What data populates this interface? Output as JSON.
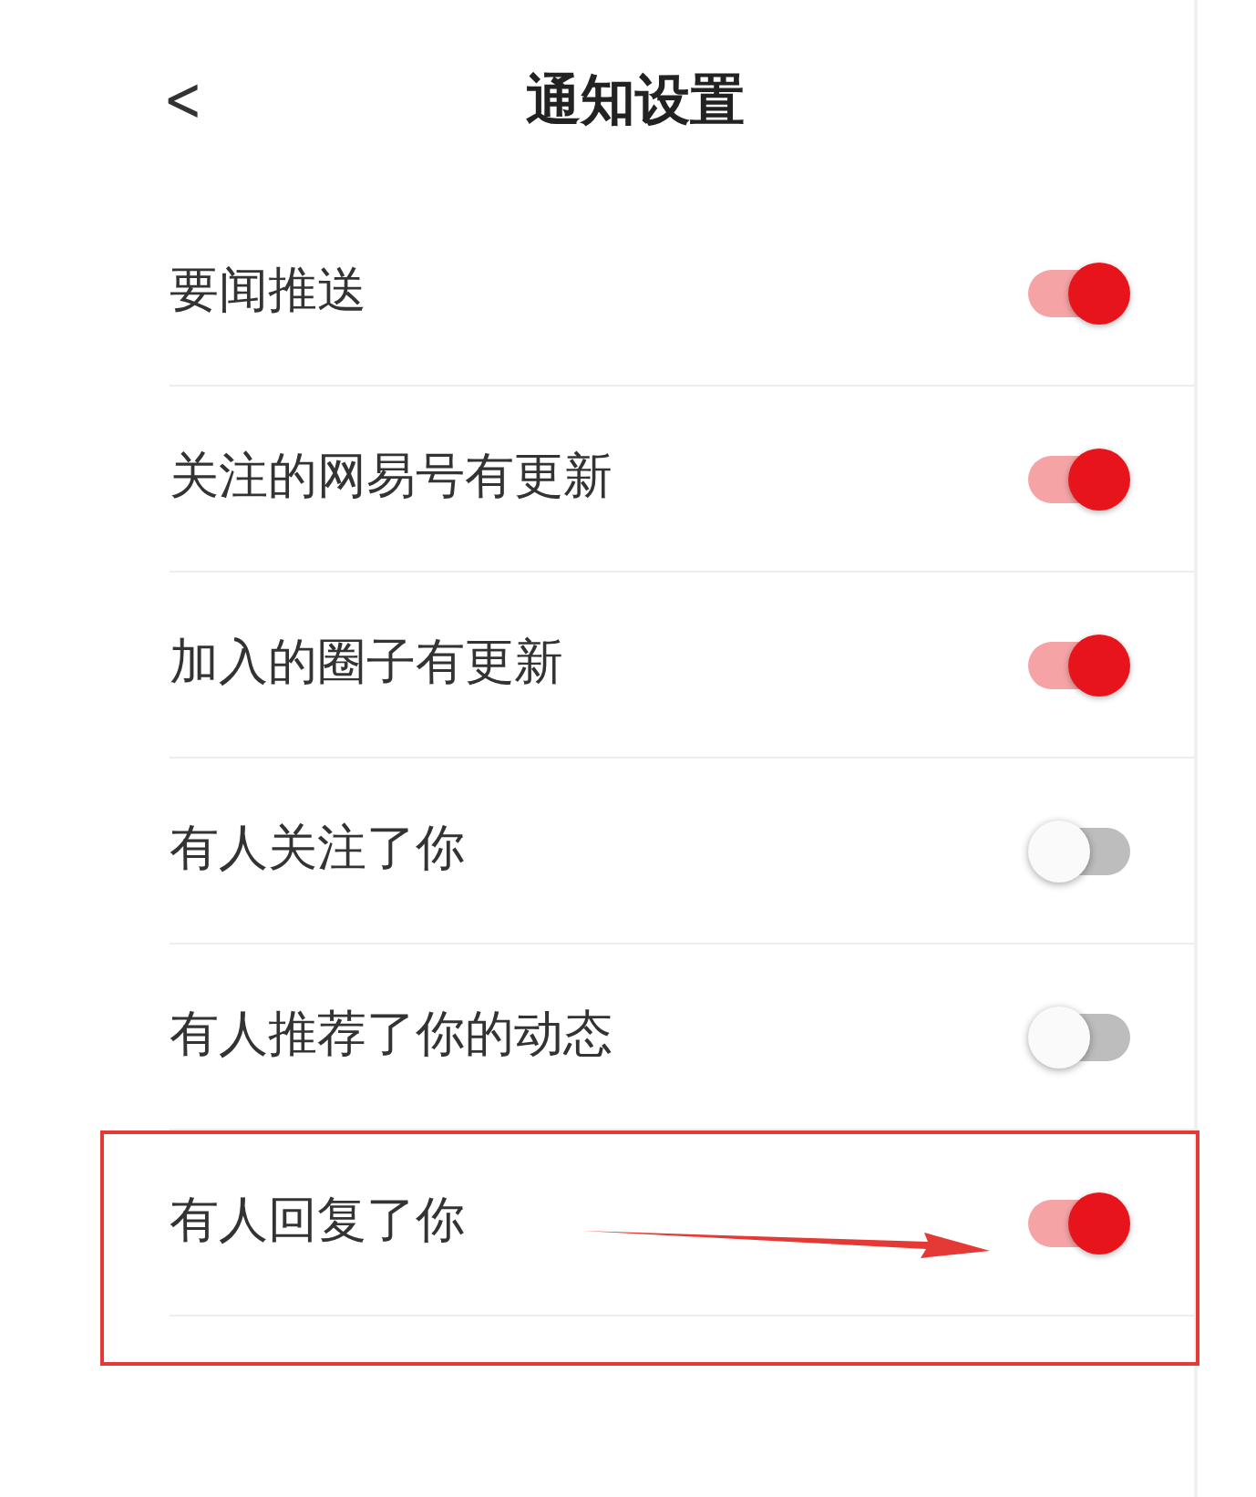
{
  "header": {
    "back": "<",
    "title": "通知设置"
  },
  "rows": [
    {
      "label": "要闻推送",
      "on": true,
      "highlighted": false
    },
    {
      "label": "关注的网易号有更新",
      "on": true,
      "highlighted": false
    },
    {
      "label": "加入的圈子有更新",
      "on": true,
      "highlighted": false
    },
    {
      "label": "有人关注了你",
      "on": false,
      "highlighted": false
    },
    {
      "label": "有人推荐了你的动态",
      "on": false,
      "highlighted": false
    },
    {
      "label": "有人回复了你",
      "on": true,
      "highlighted": true
    }
  ]
}
